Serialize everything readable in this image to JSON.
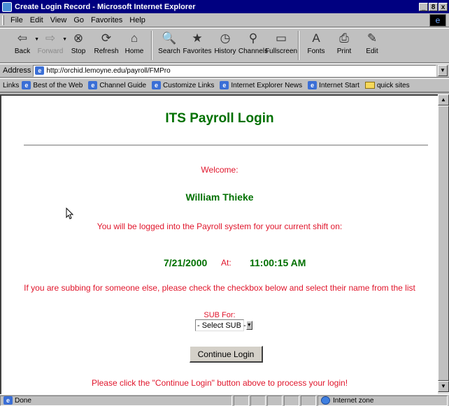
{
  "window": {
    "title": "Create Login Record - Microsoft Internet Explorer",
    "buttons": [
      "_",
      "8",
      "x"
    ]
  },
  "menu": [
    "File",
    "Edit",
    "View",
    "Go",
    "Favorites",
    "Help"
  ],
  "toolbar": {
    "buttons": [
      {
        "label": "Back",
        "icon": "back-arrow-icon",
        "glyph": "⇦",
        "disabled": false,
        "dropdown": true
      },
      {
        "label": "Forward",
        "icon": "forward-arrow-icon",
        "glyph": "⇨",
        "disabled": true,
        "dropdown": true
      },
      {
        "label": "Stop",
        "icon": "stop-icon",
        "glyph": "⊗",
        "disabled": false
      },
      {
        "label": "Refresh",
        "icon": "refresh-icon",
        "glyph": "⟳",
        "disabled": false
      },
      {
        "label": "Home",
        "icon": "home-icon",
        "glyph": "⌂",
        "disabled": false
      },
      {
        "label": "Search",
        "icon": "search-icon",
        "glyph": "🔍",
        "disabled": false
      },
      {
        "label": "Favorites",
        "icon": "favorites-icon",
        "glyph": "★",
        "disabled": false
      },
      {
        "label": "History",
        "icon": "history-icon",
        "glyph": "◷",
        "disabled": false
      },
      {
        "label": "Channels",
        "icon": "channels-icon",
        "glyph": "⚲",
        "disabled": false
      },
      {
        "label": "Fullscreen",
        "icon": "fullscreen-icon",
        "glyph": "▭",
        "disabled": false
      },
      {
        "label": "Fonts",
        "icon": "fonts-icon",
        "glyph": "A",
        "disabled": false
      },
      {
        "label": "Print",
        "icon": "print-icon",
        "glyph": "⎙",
        "disabled": false
      },
      {
        "label": "Edit",
        "icon": "edit-icon",
        "glyph": "✎",
        "disabled": false
      }
    ]
  },
  "address": {
    "label": "Address",
    "url": "http://orchid.lemoyne.edu/payroll/FMPro"
  },
  "links": {
    "label": "Links",
    "items": [
      {
        "label": "Best of the Web",
        "icon": "page-icon"
      },
      {
        "label": "Channel Guide",
        "icon": "page-icon"
      },
      {
        "label": "Customize Links",
        "icon": "page-icon"
      },
      {
        "label": "Internet Explorer News",
        "icon": "page-icon"
      },
      {
        "label": "Internet Start",
        "icon": "page-icon"
      },
      {
        "label": "quick sites",
        "icon": "folder-icon"
      }
    ]
  },
  "page": {
    "heading": "ITS Payroll Login",
    "welcome": "Welcome:",
    "user_name": "William Thieke",
    "shift_message": "You will be logged into the Payroll system for your current shift on:",
    "date": "7/21/2000",
    "at_label": "At:",
    "time": "11:00:15 AM",
    "sub_message": "If you are subbing for someone else, please check the checkbox below and select their name from the list",
    "sub_for_label": "SUB For:",
    "sub_select_value": "- Select SUB -",
    "continue_button": "Continue Login",
    "click_message": "Please click the \"Continue Login\" button above to process your login!"
  },
  "status": {
    "text": "Done",
    "zone": "Internet zone"
  },
  "colors": {
    "heading_green": "#007000",
    "message_red": "#e0152b",
    "titlebar_blue": "#000080"
  }
}
